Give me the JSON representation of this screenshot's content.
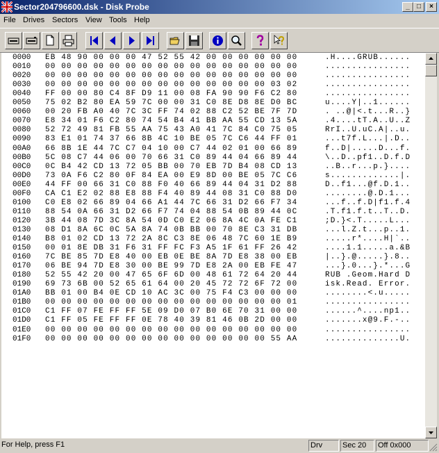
{
  "window": {
    "title": "Sector204796600.dsk - Disk Probe"
  },
  "title_buttons": [
    "_",
    "□",
    "×"
  ],
  "menu": [
    {
      "label": "File"
    },
    {
      "label": "Drives"
    },
    {
      "label": "Sectors"
    },
    {
      "label": "View"
    },
    {
      "label": "Tools"
    },
    {
      "label": "Help"
    }
  ],
  "toolbar": [
    "read-drive-icon",
    "write-drive-icon",
    "copy-icon",
    "print-icon",
    "first-sector-icon",
    "previous-sector-icon",
    "next-sector-icon",
    "last-sector-icon",
    "open-folder-icon",
    "save-disk-icon",
    "info-icon",
    "search-icon",
    "help-icon",
    "context-help-icon"
  ],
  "colors": {
    "title_start": "#0a246a",
    "title_end": "#a6caf0",
    "nav_blue": "#0000c0"
  },
  "rows": [
    {
      "addr": "0000",
      "hex": "EB 48 90 00 00 00 47 52 55 42 00 00 00 00 00 00",
      "ascii": ".H....GRUB......"
    },
    {
      "addr": "0010",
      "hex": "00 00 00 00 00 00 00 00 00 00 00 00 00 00 00 00",
      "ascii": "................"
    },
    {
      "addr": "0020",
      "hex": "00 00 00 00 00 00 00 00 00 00 00 00 00 00 00 00",
      "ascii": "................"
    },
    {
      "addr": "0030",
      "hex": "00 00 00 00 00 00 00 00 00 00 00 00 00 00 03 02",
      "ascii": "................"
    },
    {
      "addr": "0040",
      "hex": "FF 00 00 80 C4 8F D9 11 00 08 FA 90 90 F6 C2 80",
      "ascii": "................"
    },
    {
      "addr": "0050",
      "hex": "75 02 B2 80 EA 59 7C 00 00 31 C0 8E D8 8E D0 BC",
      "ascii": "u....Y|..1......"
    },
    {
      "addr": "0060",
      "hex": "00 20 FB A0 40 7C 3C FF 74 02 88 C2 52 BE 7F 7D",
      "ascii": ". ..@|<.t...R..}"
    },
    {
      "addr": "0070",
      "hex": "E8 34 01 F6 C2 80 74 54 B4 41 BB AA 55 CD 13 5A",
      "ascii": ".4....tT.A..U..Z"
    },
    {
      "addr": "0080",
      "hex": "52 72 49 81 FB 55 AA 75 43 A0 41 7C 84 C0 75 05",
      "ascii": "RrI..U.uC.A|..u."
    },
    {
      "addr": "0090",
      "hex": "83 E1 01 74 37 66 8B 4C 10 BE 05 7C C6 44 FF 01",
      "ascii": "...t7f.L...|.D.."
    },
    {
      "addr": "00A0",
      "hex": "66 8B 1E 44 7C C7 04 10 00 C7 44 02 01 00 66 89",
      "ascii": "f..D|.....D...f."
    },
    {
      "addr": "00B0",
      "hex": "5C 08 C7 44 06 00 70 66 31 C0 89 44 04 66 89 44",
      "ascii": "\\..D..pf1..D.f.D"
    },
    {
      "addr": "00C0",
      "hex": "0C B4 42 CD 13 72 05 BB 00 70 EB 7D B4 08 CD 13",
      "ascii": "..B..r...p.}...."
    },
    {
      "addr": "00D0",
      "hex": "73 0A F6 C2 80 0F 84 EA 00 E9 8D 00 BE 05 7C C6",
      "ascii": "s.............|."
    },
    {
      "addr": "00E0",
      "hex": "44 FF 00 66 31 C0 88 F0 40 66 89 44 04 31 D2 88",
      "ascii": "D..f1...@f.D.1.."
    },
    {
      "addr": "00F0",
      "hex": "CA C1 E2 02 88 E8 88 F4 40 89 44 08 31 C0 88 D0",
      "ascii": "........@.D.1..."
    },
    {
      "addr": "0100",
      "hex": "C0 E8 02 66 89 04 66 A1 44 7C 66 31 D2 66 F7 34",
      "ascii": "...f..f.D|f1.f.4"
    },
    {
      "addr": "0110",
      "hex": "88 54 0A 66 31 D2 66 F7 74 04 88 54 0B 89 44 0C",
      "ascii": ".T.f1.f.t..T..D."
    },
    {
      "addr": "0120",
      "hex": "3B 44 08 7D 3C 8A 54 0D C0 E2 06 8A 4C 0A FE C1",
      "ascii": ";D.}<.T.....L..."
    },
    {
      "addr": "0130",
      "hex": "08 D1 8A 6C 0C 5A 8A 74 0B BB 00 70 8E C3 31 DB",
      "ascii": "...l.Z.t...p..1."
    },
    {
      "addr": "0140",
      "hex": "B8 01 02 CD 13 72 2A 8C C3 8E 06 48 7C 60 1E B9",
      "ascii": ".....r*....H|`.."
    },
    {
      "addr": "0150",
      "hex": "00 01 8E DB 31 F6 31 FF FC F3 A5 1F 61 FF 26 42",
      "ascii": "....1.1.....a.&B"
    },
    {
      "addr": "0160",
      "hex": "7C BE 85 7D E8 40 00 EB 0E BE 8A 7D E8 38 00 EB",
      "ascii": "|..}.@.....}.8.."
    },
    {
      "addr": "0170",
      "hex": "06 BE 94 7D E8 30 00 BE 99 7D E8 2A 00 EB FE 47",
      "ascii": "...}.0...}.*...G"
    },
    {
      "addr": "0180",
      "hex": "52 55 42 20 00 47 65 6F 6D 00 48 61 72 64 20 44",
      "ascii": "RUB .Geom.Hard D"
    },
    {
      "addr": "0190",
      "hex": "69 73 6B 00 52 65 61 64 00 20 45 72 72 6F 72 00",
      "ascii": "isk.Read. Error."
    },
    {
      "addr": "01A0",
      "hex": "BB 01 00 B4 0E CD 10 AC 3C 00 75 F4 C3 00 00 00",
      "ascii": "........<.u....."
    },
    {
      "addr": "01B0",
      "hex": "00 00 00 00 00 00 00 00 00 00 00 00 00 00 00 01",
      "ascii": "................"
    },
    {
      "addr": "01C0",
      "hex": "C1 FF 07 FE FF FF 5E 09 D0 07 B0 6E 70 31 00 00",
      "ascii": "......^....np1.."
    },
    {
      "addr": "01D0",
      "hex": "C1 FF 05 FE FF FF 0E 78 40 39 81 46 0B 2D 00 00",
      "ascii": ".......x@9.F.-.."
    },
    {
      "addr": "01E0",
      "hex": "00 00 00 00 00 00 00 00 00 00 00 00 00 00 00 00",
      "ascii": "................"
    },
    {
      "addr": "01F0",
      "hex": "00 00 00 00 00 00 00 00 00 00 00 00 00 00 55 AA",
      "ascii": "..............U."
    }
  ],
  "status": {
    "help": "For Help, press F1",
    "drive": "Drv",
    "sector": "Sec 20",
    "offset": "Off 0x000"
  }
}
